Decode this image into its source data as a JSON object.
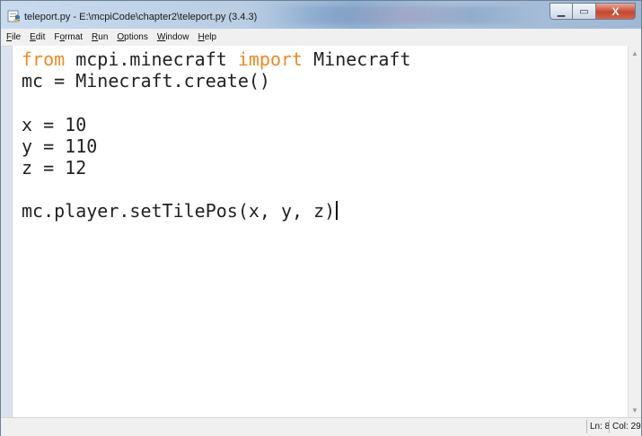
{
  "window": {
    "title": "teleport.py - E:\\mcpiCode\\chapter2\\teleport.py (3.4.3)",
    "buttons": {
      "minimize": "▁",
      "maximize": "▭",
      "close": "X"
    }
  },
  "menu": {
    "items": [
      {
        "mnemonic": "F",
        "rest": "ile"
      },
      {
        "mnemonic": "E",
        "rest": "dit"
      },
      {
        "pre": "F",
        "mnemonic": "o",
        "rest": "rmat"
      },
      {
        "mnemonic": "R",
        "rest": "un"
      },
      {
        "mnemonic": "O",
        "rest": "ptions"
      },
      {
        "mnemonic": "W",
        "rest": "indow"
      },
      {
        "mnemonic": "H",
        "rest": "elp"
      }
    ]
  },
  "code": {
    "line1": {
      "kw_from": "from",
      "module": " mcpi.minecraft ",
      "kw_import": "import",
      "name": " Minecraft"
    },
    "line2": "mc = Minecraft.create()",
    "line3": "",
    "line4": "x = 10",
    "line5": "y = 110",
    "line6": "z = 12",
    "line7": "",
    "line8": "mc.player.setTilePos(x, y, z)"
  },
  "status": {
    "ln": "Ln: 8",
    "col": "Col: 29"
  },
  "colors": {
    "keyword": "#f08a24",
    "text": "#222222",
    "close_button": "#c5472f"
  },
  "icons": {
    "app": "python-idle-icon",
    "scroll_up": "scroll-up-arrow-icon",
    "scroll_down": "scroll-down-arrow-icon"
  }
}
